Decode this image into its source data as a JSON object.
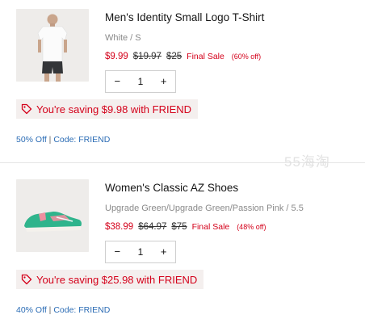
{
  "items": [
    {
      "name": "Men's Identity Small Logo T-Shirt",
      "variant": "White / S",
      "price": "$9.99",
      "compare_price_1": "$19.97",
      "compare_price_2": "$25",
      "final_sale": "Final Sale",
      "discount": "(60% off)",
      "quantity": "1",
      "minus": "−",
      "plus": "+",
      "saving_text": "You're saving $9.98 with FRIEND",
      "promo_text": "50% Off",
      "promo_sep": "|",
      "promo_code": "Code: FRIEND"
    },
    {
      "name": "Women's Classic AZ Shoes",
      "variant": "Upgrade Green/Upgrade Green/Passion Pink / 5.5",
      "price": "$38.99",
      "compare_price_1": "$64.97",
      "compare_price_2": "$75",
      "final_sale": "Final Sale",
      "discount": "(48% off)",
      "quantity": "1",
      "minus": "−",
      "plus": "+",
      "saving_text": "You're saving $25.98 with FRIEND",
      "promo_text": "40% Off",
      "promo_sep": "|",
      "promo_code": "Code: FRIEND"
    }
  ],
  "watermark": "55海淘",
  "colors": {
    "sale": "#d4001a",
    "link": "#2b6cb5",
    "badge_bg": "#f4efee"
  },
  "icons": {
    "saving": "tag-icon"
  }
}
